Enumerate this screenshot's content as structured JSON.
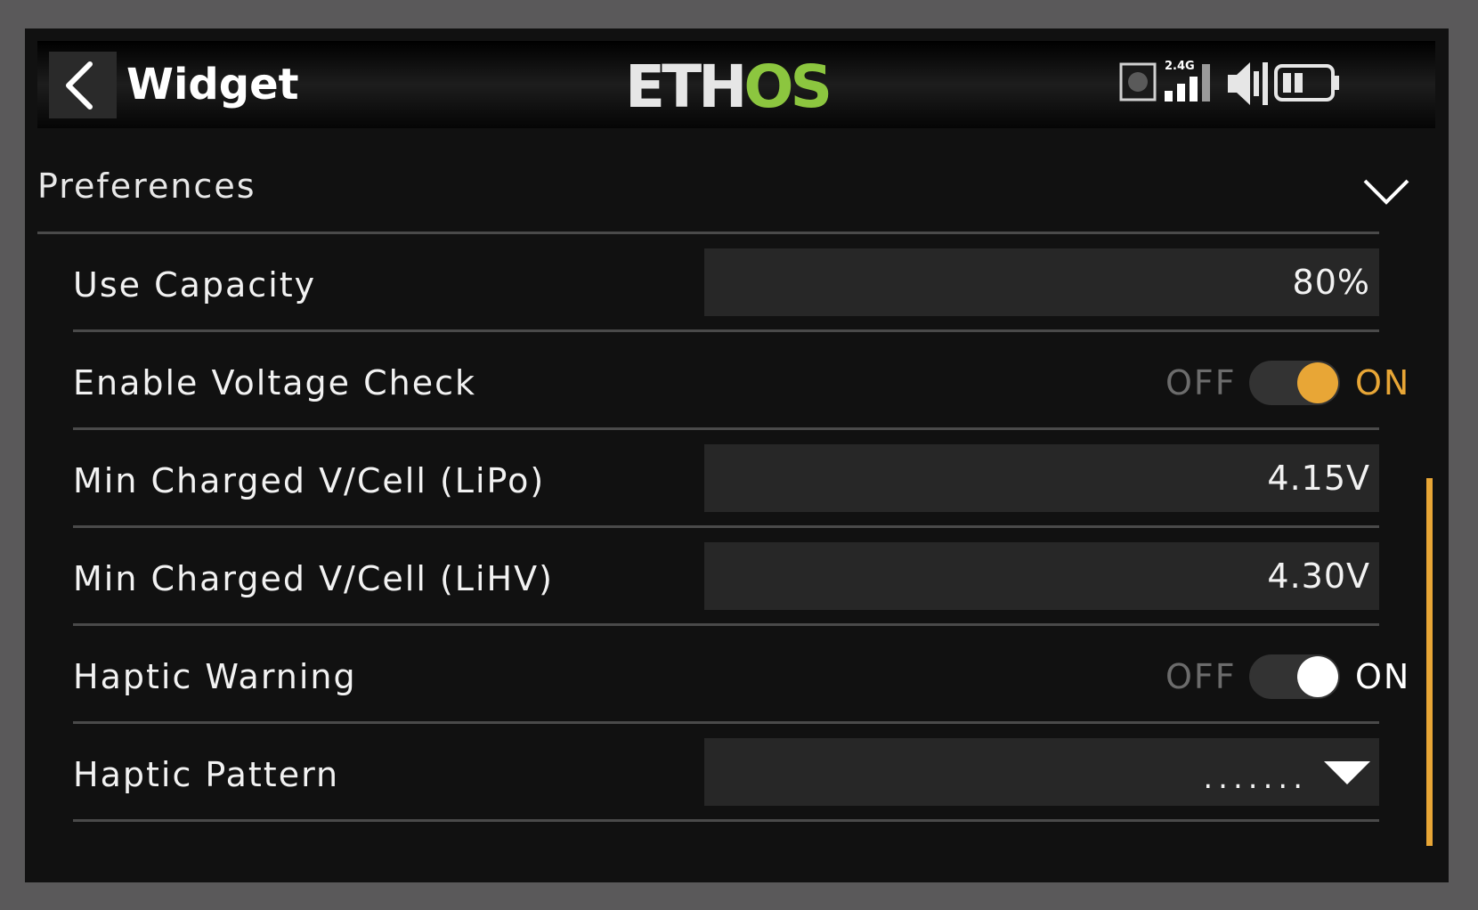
{
  "header": {
    "title": "Widget",
    "logo_left": "ETH",
    "logo_right": "OS",
    "band_label": "2.4G"
  },
  "colors": {
    "accent": "#e8a636",
    "logo_green": "#8cc63f",
    "background": "#111111",
    "field": "#272727"
  },
  "section": {
    "title": "Preferences"
  },
  "rows": {
    "use_capacity": {
      "label": "Use Capacity",
      "value": "80%"
    },
    "voltage_check": {
      "label": "Enable Voltage Check",
      "off": "OFF",
      "on": "ON",
      "state": "on"
    },
    "lipo": {
      "label": "Min Charged V/Cell (LiPo)",
      "value": "4.15V"
    },
    "lihv": {
      "label": "Min Charged V/Cell (LiHV)",
      "value": "4.30V"
    },
    "haptic_warning": {
      "label": "Haptic Warning",
      "off": "OFF",
      "on": "ON",
      "state": "on"
    },
    "haptic_pattern": {
      "label": "Haptic Pattern",
      "value": "......."
    }
  },
  "icons": [
    "back-arrow-icon",
    "record-icon",
    "signal-bars-icon",
    "speaker-icon",
    "battery-icon",
    "chevron-down-icon",
    "dropdown-triangle-icon"
  ]
}
